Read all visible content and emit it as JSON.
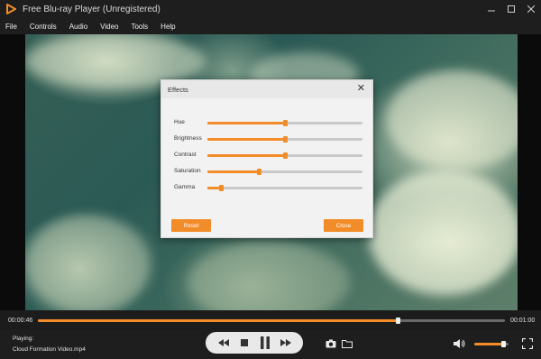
{
  "window": {
    "title": "Free Blu-ray Player (Unregistered)"
  },
  "menu": [
    "File",
    "Controls",
    "Audio",
    "Video",
    "Tools",
    "Help"
  ],
  "effects": {
    "title": "Effects",
    "sliders": [
      {
        "label": "Hue",
        "value": 0.5
      },
      {
        "label": "Brightness",
        "value": 0.5
      },
      {
        "label": "Contrast",
        "value": 0.5
      },
      {
        "label": "Saturation",
        "value": 0.33
      },
      {
        "label": "Gamma",
        "value": 0.09
      }
    ],
    "reset_label": "Reset",
    "close_label": "Close"
  },
  "playback": {
    "current_time": "00:00:46",
    "total_time": "00:01:00",
    "progress": 0.77,
    "playing_label": "Playing:",
    "file_name": "Cloud Formation Video.mp4",
    "volume": 0.85
  },
  "colors": {
    "accent": "#f28c28",
    "titlebar": "#1e1e1e",
    "dialog": "#f2f2f2"
  },
  "icons": {
    "app": "play-triangle-logo-icon",
    "minimize": "minimize-icon",
    "maximize": "maximize-icon",
    "close": "close-icon",
    "rewind": "rewind-icon",
    "stop": "stop-icon",
    "pause": "pause-icon",
    "forward": "fast-forward-icon",
    "snapshot": "camera-icon",
    "folder": "folder-icon",
    "volume": "speaker-icon",
    "fullscreen": "fullscreen-icon"
  }
}
